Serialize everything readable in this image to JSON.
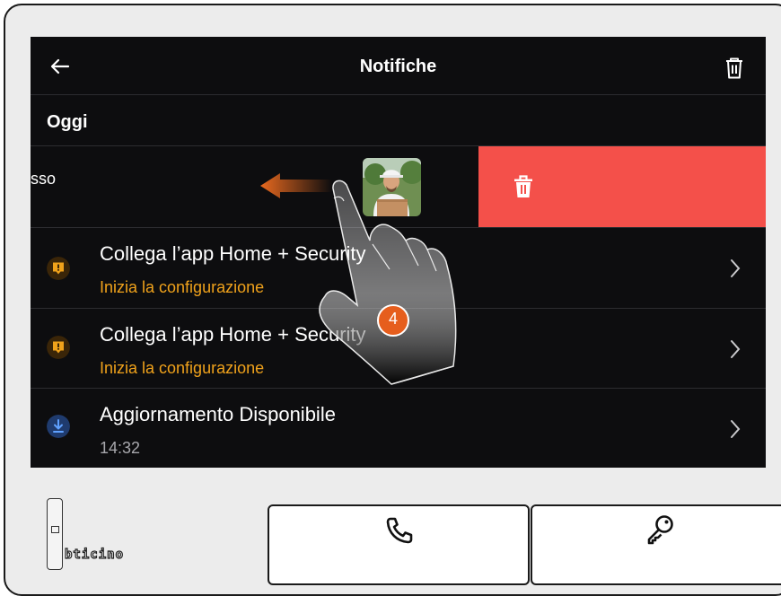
{
  "header": {
    "title": "Notifiche",
    "back_icon": "arrow-left-icon",
    "delete_all_icon": "trash-icon"
  },
  "section": {
    "title": "Oggi"
  },
  "swiped_item": {
    "visible_text": "sso",
    "delete_icon": "trash-icon",
    "delete_color": "#f4504a"
  },
  "notifications": [
    {
      "title": "Collega l’app Home + Security",
      "subtitle": "Inizia la configurazione",
      "icon": "alert-badge-icon",
      "icon_color": "#f0a21b",
      "subtitle_color": "#f0a21b"
    },
    {
      "title": "Collega l’app Home + Security",
      "subtitle": "Inizia la configurazione",
      "icon": "alert-badge-icon",
      "icon_color": "#f0a21b",
      "subtitle_color": "#f0a21b"
    },
    {
      "title": "Aggiornamento Disponibile",
      "subtitle": "14:32",
      "icon": "download-icon",
      "icon_color": "#2f6fe0",
      "subtitle_color": "#a8a8ad"
    }
  ],
  "step": {
    "number": "4"
  },
  "device": {
    "brand": "bticino",
    "call_button_icon": "phone-icon",
    "key_button_icon": "key-icon"
  }
}
